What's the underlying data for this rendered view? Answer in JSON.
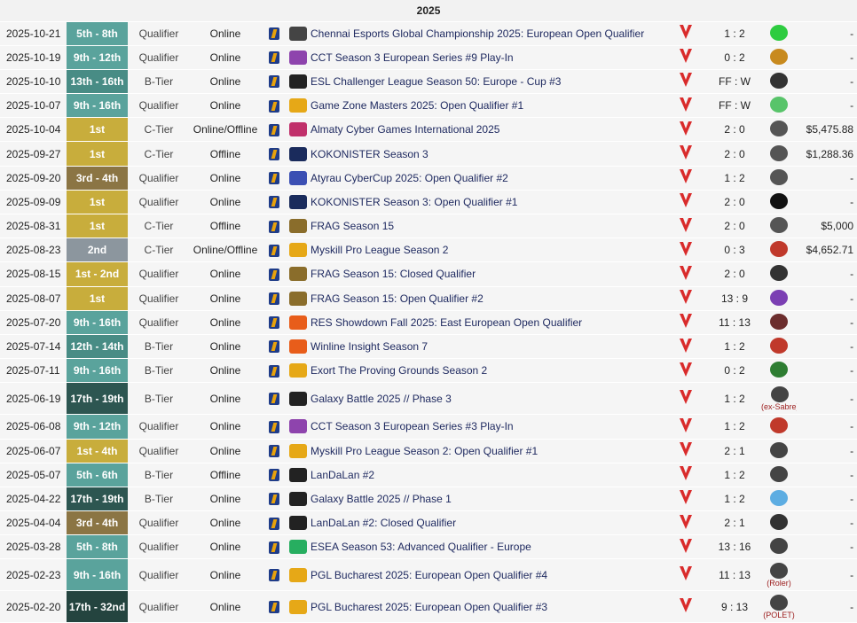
{
  "year": "2025",
  "rows": [
    {
      "date": "2025-10-21",
      "place": "5th - 8th",
      "pc": "teal",
      "tier": "Qualifier",
      "loc": "Online",
      "tname": "Chennai Esports Global Championship 2025: European Open Qualifier",
      "tl": "#444444",
      "score": "1 : 2",
      "oc": "#2ecc40",
      "note": "",
      "prize": "-"
    },
    {
      "date": "2025-10-19",
      "place": "9th - 12th",
      "pc": "teal",
      "tier": "Qualifier",
      "loc": "Online",
      "tname": "CCT Season 3 European Series #9 Play-In",
      "tl": "#8e44ad",
      "score": "0 : 2",
      "oc": "#c88a1e",
      "note": "",
      "prize": "-"
    },
    {
      "date": "2025-10-10",
      "place": "13th - 16th",
      "pc": "teal2",
      "tier": "B-Tier",
      "loc": "Online",
      "tname": "ESL Challenger League Season 50: Europe - Cup #3",
      "tl": "#222222",
      "score": "FF : W",
      "oc": "#333333",
      "note": "",
      "prize": "-"
    },
    {
      "date": "2025-10-07",
      "place": "9th - 16th",
      "pc": "teal",
      "tier": "Qualifier",
      "loc": "Online",
      "tname": "Game Zone Masters 2025: Open Qualifier #1",
      "tl": "#e6a817",
      "score": "FF : W",
      "oc": "#58c46a",
      "note": "",
      "prize": "-"
    },
    {
      "date": "2025-10-04",
      "place": "1st",
      "pc": "gold",
      "tier": "C-Tier",
      "loc": "Online/Offline",
      "tname": "Almaty Cyber Games International 2025",
      "tl": "#c0306a",
      "score": "2 : 0",
      "oc": "#555555",
      "note": "",
      "prize": "$5,475.88"
    },
    {
      "date": "2025-09-27",
      "place": "1st",
      "pc": "gold",
      "tier": "C-Tier",
      "loc": "Offline",
      "tname": "KOKONISTER Season 3",
      "tl": "#1a2b5c",
      "score": "2 : 0",
      "oc": "#555555",
      "note": "",
      "prize": "$1,288.36"
    },
    {
      "date": "2025-09-20",
      "place": "3rd - 4th",
      "pc": "bronze",
      "tier": "Qualifier",
      "loc": "Online",
      "tname": "Atyrau CyberCup 2025: Open Qualifier #2",
      "tl": "#3b4fb3",
      "score": "1 : 2",
      "oc": "#555555",
      "note": "",
      "prize": "-"
    },
    {
      "date": "2025-09-09",
      "place": "1st",
      "pc": "gold",
      "tier": "Qualifier",
      "loc": "Online",
      "tname": "KOKONISTER Season 3: Open Qualifier #1",
      "tl": "#1a2b5c",
      "score": "2 : 0",
      "oc": "#111111",
      "note": "",
      "prize": "-"
    },
    {
      "date": "2025-08-31",
      "place": "1st",
      "pc": "gold",
      "tier": "C-Tier",
      "loc": "Offline",
      "tname": "FRAG Season 15",
      "tl": "#8a6d2b",
      "score": "2 : 0",
      "oc": "#555555",
      "note": "",
      "prize": "$5,000"
    },
    {
      "date": "2025-08-23",
      "place": "2nd",
      "pc": "silver",
      "tier": "C-Tier",
      "loc": "Online/Offline",
      "tname": "Myskill Pro League Season 2",
      "tl": "#e6a817",
      "score": "0 : 3",
      "oc": "#c0392b",
      "note": "",
      "prize": "$4,652.71"
    },
    {
      "date": "2025-08-15",
      "place": "1st - 2nd",
      "pc": "gold",
      "tier": "Qualifier",
      "loc": "Online",
      "tname": "FRAG Season 15: Closed Qualifier",
      "tl": "#8a6d2b",
      "score": "2 : 0",
      "oc": "#333333",
      "note": "",
      "prize": "-"
    },
    {
      "date": "2025-08-07",
      "place": "1st",
      "pc": "gold",
      "tier": "Qualifier",
      "loc": "Online",
      "tname": "FRAG Season 15: Open Qualifier #2",
      "tl": "#8a6d2b",
      "score": "13 : 9",
      "oc": "#7b3fb3",
      "note": "",
      "prize": "-"
    },
    {
      "date": "2025-07-20",
      "place": "9th - 16th",
      "pc": "teal",
      "tier": "Qualifier",
      "loc": "Online",
      "tname": "RES Showdown Fall 2025: East European Open Qualifier",
      "tl": "#e85d1a",
      "score": "11 : 13",
      "oc": "#6b2d2d",
      "note": "",
      "prize": "-"
    },
    {
      "date": "2025-07-14",
      "place": "12th - 14th",
      "pc": "teal2",
      "tier": "B-Tier",
      "loc": "Online",
      "tname": "Winline Insight Season 7",
      "tl": "#e85d1a",
      "score": "1 : 2",
      "oc": "#c0392b",
      "note": "",
      "prize": "-"
    },
    {
      "date": "2025-07-11",
      "place": "9th - 16th",
      "pc": "teal",
      "tier": "B-Tier",
      "loc": "Online",
      "tname": "Exort The Proving Grounds Season 2",
      "tl": "#e6a817",
      "score": "0 : 2",
      "oc": "#2e7d32",
      "note": "",
      "prize": "-"
    },
    {
      "date": "2025-06-19",
      "place": "17th - 19th",
      "pc": "dark",
      "tier": "B-Tier",
      "loc": "Online",
      "tname": "Galaxy Battle 2025 // Phase 3",
      "tl": "#222222",
      "score": "1 : 2",
      "oc": "#444444",
      "note": "(ex-Sabre)",
      "prize": "-"
    },
    {
      "date": "2025-06-08",
      "place": "9th - 12th",
      "pc": "teal",
      "tier": "Qualifier",
      "loc": "Online",
      "tname": "CCT Season 3 European Series #3 Play-In",
      "tl": "#8e44ad",
      "score": "1 : 2",
      "oc": "#c0392b",
      "note": "",
      "prize": "-"
    },
    {
      "date": "2025-06-07",
      "place": "1st - 4th",
      "pc": "gold",
      "tier": "Qualifier",
      "loc": "Online",
      "tname": "Myskill Pro League Season 2: Open Qualifier #1",
      "tl": "#e6a817",
      "score": "2 : 1",
      "oc": "#444444",
      "note": "",
      "prize": "-"
    },
    {
      "date": "2025-05-07",
      "place": "5th - 6th",
      "pc": "teal",
      "tier": "B-Tier",
      "loc": "Offline",
      "tname": "LanDaLan #2",
      "tl": "#222222",
      "score": "1 : 2",
      "oc": "#444444",
      "note": "",
      "prize": "-"
    },
    {
      "date": "2025-04-22",
      "place": "17th - 19th",
      "pc": "dark",
      "tier": "B-Tier",
      "loc": "Online",
      "tname": "Galaxy Battle 2025 // Phase 1",
      "tl": "#222222",
      "score": "1 : 2",
      "oc": "#5dade2",
      "note": "",
      "prize": "-"
    },
    {
      "date": "2025-04-04",
      "place": "3rd - 4th",
      "pc": "bronze",
      "tier": "Qualifier",
      "loc": "Online",
      "tname": "LanDaLan #2: Closed Qualifier",
      "tl": "#222222",
      "score": "2 : 1",
      "oc": "#333333",
      "note": "",
      "prize": "-"
    },
    {
      "date": "2025-03-28",
      "place": "5th - 8th",
      "pc": "teal",
      "tier": "Qualifier",
      "loc": "Online",
      "tname": "ESEA Season 53: Advanced Qualifier - Europe",
      "tl": "#27ae60",
      "score": "13 : 16",
      "oc": "#444444",
      "note": "",
      "prize": "-"
    },
    {
      "date": "2025-02-23",
      "place": "9th - 16th",
      "pc": "teal",
      "tier": "Qualifier",
      "loc": "Online",
      "tname": "PGL Bucharest 2025: European Open Qualifier #4",
      "tl": "#e6a817",
      "score": "11 : 13",
      "oc": "#444444",
      "note": "(Roler)",
      "prize": "-"
    },
    {
      "date": "2025-02-20",
      "place": "17th - 32nd",
      "pc": "darker",
      "tier": "Qualifier",
      "loc": "Online",
      "tname": "PGL Bucharest 2025: European Open Qualifier #3",
      "tl": "#e6a817",
      "score": "9 : 13",
      "oc": "#444444",
      "note": "(POLET)",
      "prize": "-"
    }
  ]
}
